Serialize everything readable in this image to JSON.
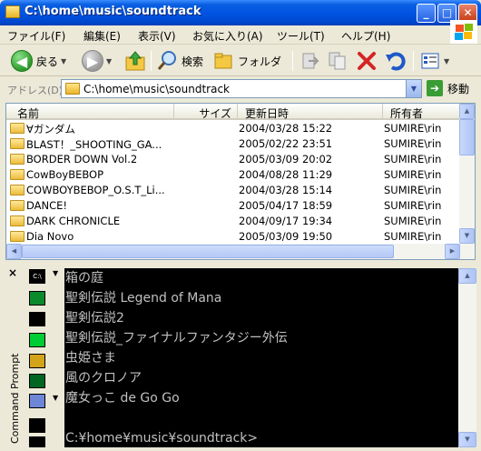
{
  "window": {
    "title": "C:\\home\\music\\soundtrack",
    "min_glyph": "_",
    "max_glyph": "□",
    "close_glyph": "✕"
  },
  "menu": [
    "ファイル(F)",
    "編集(E)",
    "表示(V)",
    "お気に入り(A)",
    "ツール(T)",
    "ヘルプ(H)"
  ],
  "toolbar": {
    "back_label": "戻る",
    "search_label": "検索",
    "folders_label": "フォルダ",
    "icons": [
      "back-arrow-icon",
      "forward-arrow-icon",
      "up-folder-icon",
      "search-magnifier-icon",
      "folders-icon",
      "move-to-icon",
      "copy-to-icon",
      "delete-x-icon",
      "undo-icon",
      "views-icon"
    ]
  },
  "address": {
    "label": "アドレス(D)",
    "value": "C:\\home\\music\\soundtrack",
    "go_label": "移動"
  },
  "columns": [
    "名前",
    "サイズ",
    "更新日時",
    "所有者"
  ],
  "files": [
    {
      "name": "∀ガンダム",
      "size": "",
      "modified": "2004/03/28 15:22",
      "owner": "SUMIRE\\rin"
    },
    {
      "name": "BLAST！_SHOOTING_GA...",
      "size": "",
      "modified": "2005/02/22 23:51",
      "owner": "SUMIRE\\rin"
    },
    {
      "name": "BORDER DOWN Vol.2",
      "size": "",
      "modified": "2005/03/09 20:02",
      "owner": "SUMIRE\\rin"
    },
    {
      "name": "CowBoyBEBOP",
      "size": "",
      "modified": "2004/08/28 11:29",
      "owner": "SUMIRE\\rin"
    },
    {
      "name": "COWBOYBEBOP_O.S.T_Li...",
      "size": "",
      "modified": "2004/03/28 15:14",
      "owner": "SUMIRE\\rin"
    },
    {
      "name": "DANCE!",
      "size": "",
      "modified": "2005/04/17 18:59",
      "owner": "SUMIRE\\rin"
    },
    {
      "name": "DARK CHRONICLE",
      "size": "",
      "modified": "2004/09/17 19:34",
      "owner": "SUMIRE\\rin"
    },
    {
      "name": "Dia Novo",
      "size": "",
      "modified": "2005/03/09 19:50",
      "owner": "SUMIRE\\rin"
    }
  ],
  "command_panel": {
    "title": "Command Prompt",
    "close_glyph": "×",
    "lines": [
      "箱の庭",
      "聖剣伝説 Legend of Mana",
      "聖剣伝説2",
      "聖剣伝説_ファイナルファンタジー外伝",
      "虫姫さま",
      "風のクロノア",
      "魔女っこ de Go Go",
      "",
      "C:¥home¥music¥soundtrack>"
    ],
    "tool_icons": [
      "cmd-prompt-icon",
      "run-arrow-icon",
      "black-window-icon",
      "green-window-icon",
      "export-arrow-icon",
      "dark-green-icon",
      "wrench-icon",
      "copy-window-icon"
    ]
  }
}
